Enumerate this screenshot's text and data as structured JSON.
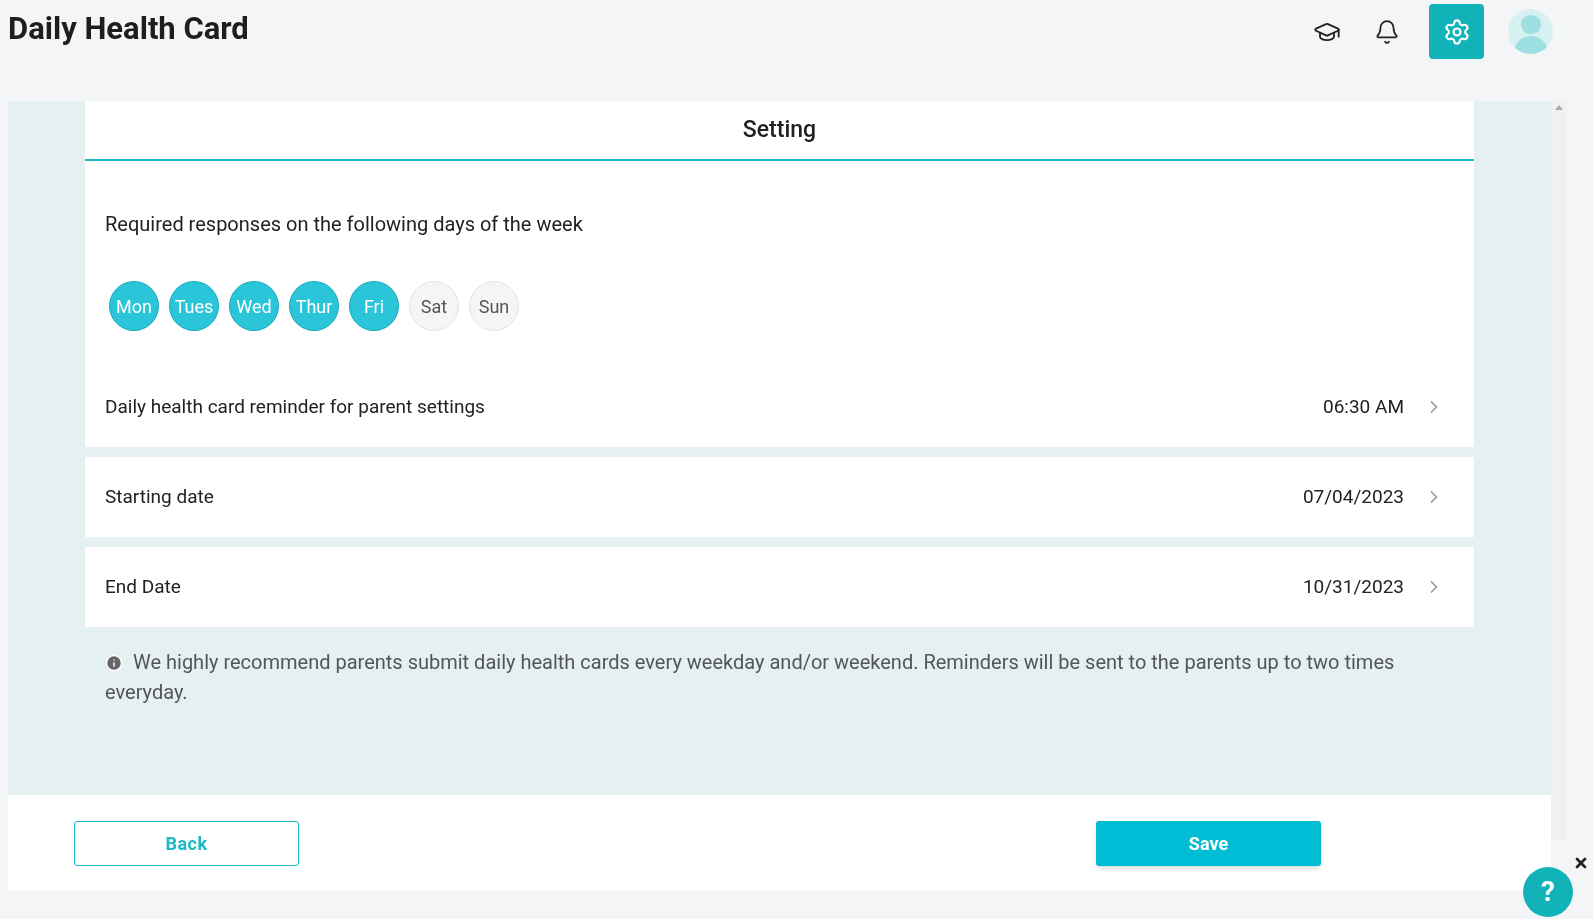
{
  "header": {
    "title": "Daily Health Card",
    "settings_active": true
  },
  "card": {
    "title": "Setting",
    "days_label": "Required responses on the following days of the week",
    "days": [
      {
        "label": "Mon",
        "selected": true
      },
      {
        "label": "Tues",
        "selected": true
      },
      {
        "label": "Wed",
        "selected": true
      },
      {
        "label": "Thur",
        "selected": true
      },
      {
        "label": "Fri",
        "selected": true
      },
      {
        "label": "Sat",
        "selected": false
      },
      {
        "label": "Sun",
        "selected": false
      }
    ],
    "rows": [
      {
        "label": "Daily health card reminder for parent settings",
        "value": "06:30 AM"
      },
      {
        "label": "Starting date",
        "value": "07/04/2023"
      },
      {
        "label": "End Date",
        "value": "10/31/2023"
      }
    ]
  },
  "note": "We highly recommend parents submit daily health cards every weekday and/or weekend. Reminders will be sent to the parents up to two times everyday.",
  "buttons": {
    "back": "Back",
    "save": "Save"
  },
  "help": {
    "label": "?"
  }
}
